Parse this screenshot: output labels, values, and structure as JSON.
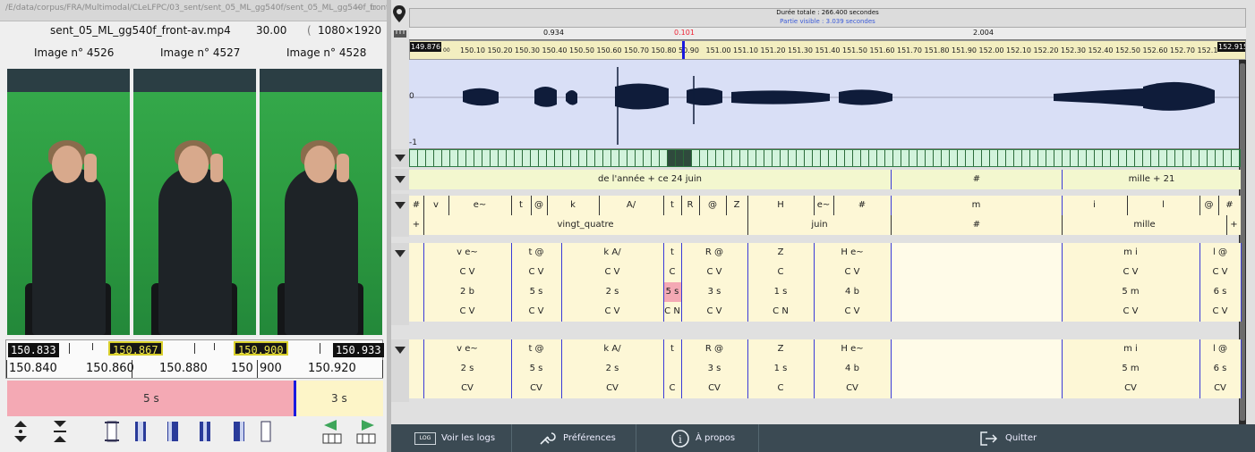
{
  "left_panel": {
    "path": "/E/data/corpus/FRA/Multimodal/CLeLFPC/03_sent/sent_05_ML_gg540f/sent_05_ML_gg540f_front",
    "file_name": "sent_05_ML_gg540f_front-av.mp4",
    "fps": "30.00",
    "resolution": "1080×1920",
    "resolution_prefix": "(",
    "frame_labels": [
      "Image n° 4526",
      "Image n° 4527",
      "Image n° 4528"
    ],
    "ruler": {
      "box_left": "150.833",
      "box_mid": "150.867",
      "box_right_yellow": "150.900",
      "box_far": "150.933",
      "tick_labels": [
        "150.840",
        "150.860",
        "150.880",
        "150",
        "900",
        "150.920"
      ]
    },
    "segment": {
      "pink_label": "5 s",
      "right_label": "3 s"
    }
  },
  "right_panel": {
    "total_duration": "Durée totale : 266.400 secondes",
    "visible_part": "Partie visible : 3.039 secondes",
    "scale_labels": [
      "0.934",
      "0.101",
      "2.004"
    ],
    "time_start": "149.876",
    "time_end": "152.915",
    "time_ticks": [
      "150.10",
      "150.20",
      "150.30",
      "150.40",
      "150.50",
      "150.60",
      "150.70",
      "150.80",
      "50.90",
      "151.00",
      "151.10",
      "151.20",
      "151.30",
      "151.40",
      "151.50",
      "151.60",
      "151.70",
      "151.80",
      "151.90",
      "152.00",
      "152.10",
      "152.20",
      "152.30",
      "152.40",
      "152.50",
      "152.60",
      "152.70",
      "152.1"
    ],
    "time_small": "00",
    "wave_zero": "0",
    "wave_neg": "-1",
    "tier1": {
      "seg1": "de l'année + ce 24 juin",
      "seg2": "#",
      "seg3": "mille + 21"
    },
    "tier2_phones": [
      "#",
      "v",
      "e~",
      "t",
      "@",
      "k",
      "A/",
      "t",
      "R",
      "@",
      "Z",
      "H",
      "e~",
      "#",
      "m",
      "i",
      "l",
      "@",
      "#"
    ],
    "tier2_words": {
      "plus_left": "+",
      "w1": "vingt_quatre",
      "w2": "juin",
      "w3": "#",
      "w4": "mille",
      "plus_right": "+"
    },
    "tier3_rows": [
      [
        "v e~",
        "t @",
        "k A/",
        "t",
        "R @",
        "Z",
        "H e~",
        "m i",
        "l @"
      ],
      [
        "C V",
        "C V",
        "C V",
        "C",
        "C V",
        "C",
        "C V",
        "C V",
        "C V"
      ],
      [
        "2 b",
        "5 s",
        "2 s",
        "5 s",
        "3 s",
        "1 s",
        "4 b",
        "5 m",
        "6 s"
      ],
      [
        "C V",
        "C V",
        "C V",
        "C N",
        "C V",
        "C N",
        "C V",
        "C V",
        "C V"
      ]
    ],
    "tier4_rows": [
      [
        "v e~",
        "t @",
        "k A/",
        "t",
        "R @",
        "Z",
        "H e~",
        "m i",
        "l @"
      ],
      [
        "2 s",
        "5 s",
        "2 s",
        "",
        "3 s",
        "1 s",
        "4 b",
        "5 m",
        "6 s"
      ],
      [
        "CV",
        "CV",
        "CV",
        "C",
        "CV",
        "C",
        "CV",
        "CV",
        "CV"
      ]
    ],
    "bottom_buttons": {
      "logs": "Voir les logs",
      "logs_icon_text": "LOG",
      "prefs": "Préférences",
      "about": "À propos",
      "quit": "Quitter"
    }
  },
  "colors": {
    "accent_yellow": "#fdf5c8",
    "pink": "#f4a9b4",
    "wave_bg": "#d9dff6",
    "bottombar": "#3b4a53",
    "blue_marker": "#1a1adf"
  }
}
